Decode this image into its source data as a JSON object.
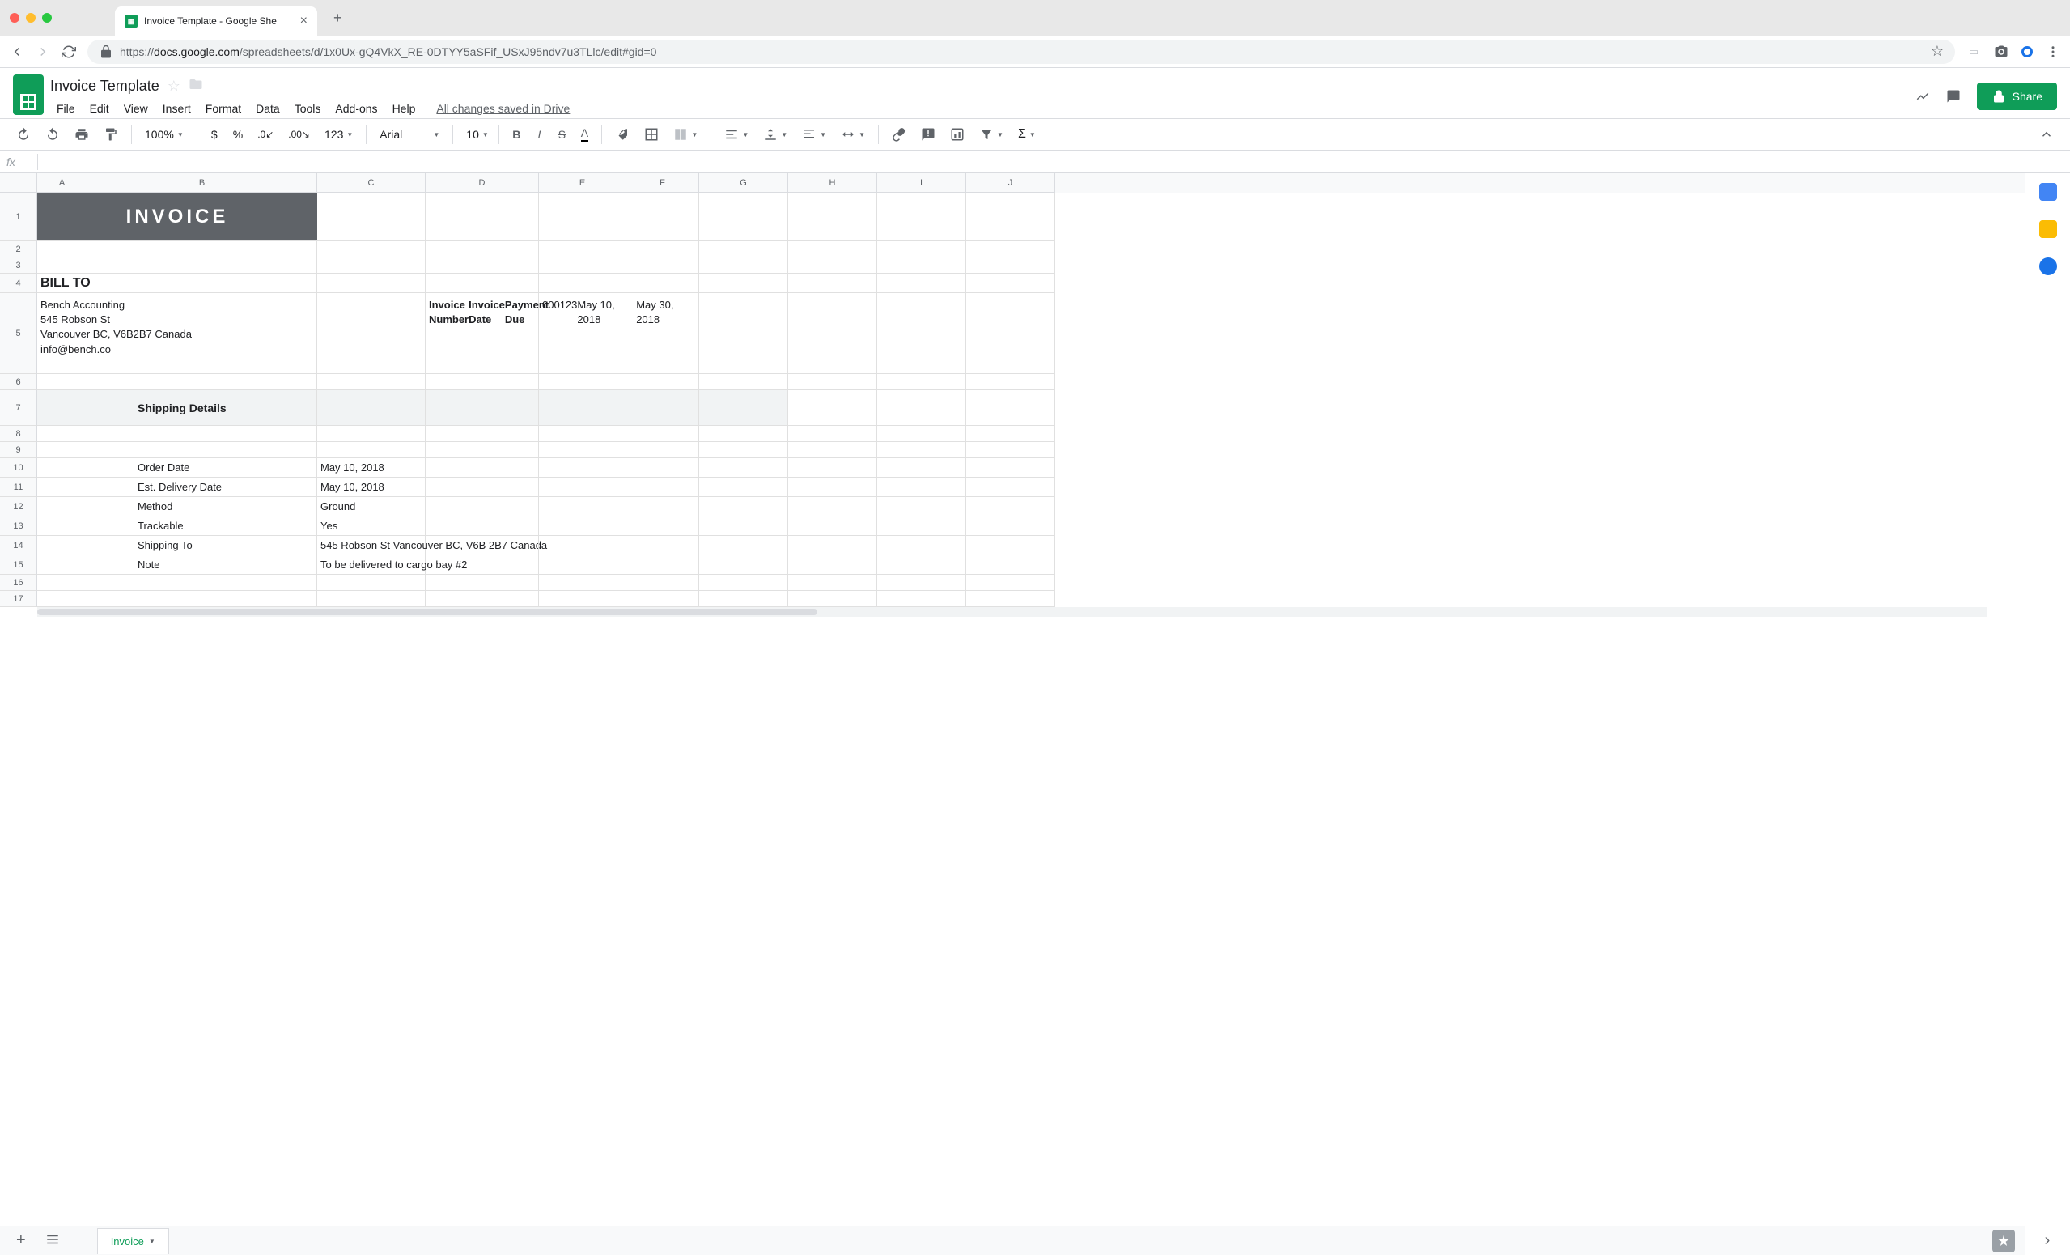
{
  "browser": {
    "tab_title": "Invoice Template - Google She",
    "url_prefix": "https://",
    "url_domain": "docs.google.com",
    "url_path": "/spreadsheets/d/1x0Ux-gQ4VkX_RE-0DTYY5aSFif_USxJ95ndv7u3TLlc/edit#gid=0"
  },
  "header": {
    "doc_title": "Invoice Template",
    "menus": [
      "File",
      "Edit",
      "View",
      "Insert",
      "Format",
      "Data",
      "Tools",
      "Add-ons",
      "Help"
    ],
    "save_status": "All changes saved in Drive",
    "share_label": "Share"
  },
  "toolbar": {
    "zoom": "100%",
    "font": "Arial",
    "font_size": "10",
    "number_format": "123"
  },
  "formula_bar": {
    "fx": "fx",
    "value": ""
  },
  "columns": [
    "A",
    "B",
    "C",
    "D",
    "E",
    "F",
    "G",
    "H",
    "I",
    "J"
  ],
  "sheet": {
    "invoice_title": "INVOICE",
    "bill_to_label": "BILL TO",
    "bill_to_value": "Bench Accounting\n545 Robson St\nVancouver BC, V6B2B7 Canada\ninfo@bench.co",
    "inv_num_label": "Invoice Number",
    "inv_num_value": "000123",
    "inv_date_label": "Invoice Date",
    "inv_date_value": "May 10, 2018",
    "pay_due_label": "Payment Due",
    "pay_due_value": "May 30, 2018",
    "shipping_header": "Shipping Details",
    "rows": [
      {
        "label": "Order Date",
        "value": "May 10, 2018"
      },
      {
        "label": "Est. Delivery Date",
        "value": "May 10, 2018"
      },
      {
        "label": "Method",
        "value": "Ground"
      },
      {
        "label": "Trackable",
        "value": "Yes"
      },
      {
        "label": "Shipping To",
        "value": "545 Robson St Vancouver BC, V6B 2B7 Canada"
      },
      {
        "label": "Note",
        "value": "To be delivered to cargo bay #2"
      }
    ]
  },
  "bottom": {
    "sheet_name": "Invoice"
  }
}
